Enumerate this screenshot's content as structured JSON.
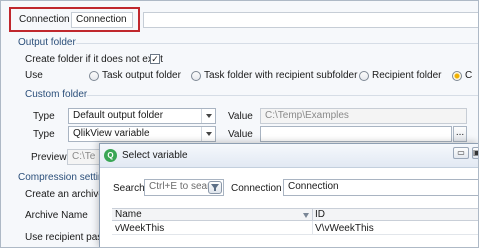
{
  "connection_bar": {
    "label": "Connection",
    "value": "Connection"
  },
  "output_folder": {
    "section_title": "Output folder",
    "create_folder_label": "Create folder if it does not exist",
    "create_folder_checked": true,
    "create_folder_check_glyph": "✓",
    "use_label": "Use",
    "use_options": [
      "Task output folder",
      "Task folder with recipient subfolder",
      "Recipient folder",
      "C"
    ]
  },
  "custom_folder": {
    "section_title": "Custom folder",
    "row1": {
      "type_label": "Type",
      "type_value": "Default output folder",
      "value_label": "Value",
      "value_value": "C:\\Temp\\Examples"
    },
    "row2": {
      "type_label": "Type",
      "type_value": "QlikView variable",
      "value_label": "Value",
      "value_value": "",
      "browse_label": "..."
    },
    "preview_label": "Preview",
    "preview_value": "C:\\Te"
  },
  "compression": {
    "section_title": "Compression setting",
    "create_archive_label": "Create an archive c",
    "archive_name_label": "Archive Name",
    "use_recipient_label": "Use recipient passw"
  },
  "dialog": {
    "title": "Select variable",
    "app_icon_glyph": "Q",
    "minimize_glyph": "▭",
    "maximize_glyph": "▣",
    "search_label": "Search",
    "search_placeholder": "Ctrl+E to search",
    "connection_label": "Connection",
    "connection_value": "Connection",
    "columns": [
      "Name",
      "ID"
    ],
    "rows": [
      {
        "name": "vWeekThis",
        "id": "V\\vWeekThis"
      }
    ]
  },
  "colors": {
    "highlight": "#c0272d",
    "section": "#2b4f7a",
    "app_icon": "#3aa655"
  }
}
